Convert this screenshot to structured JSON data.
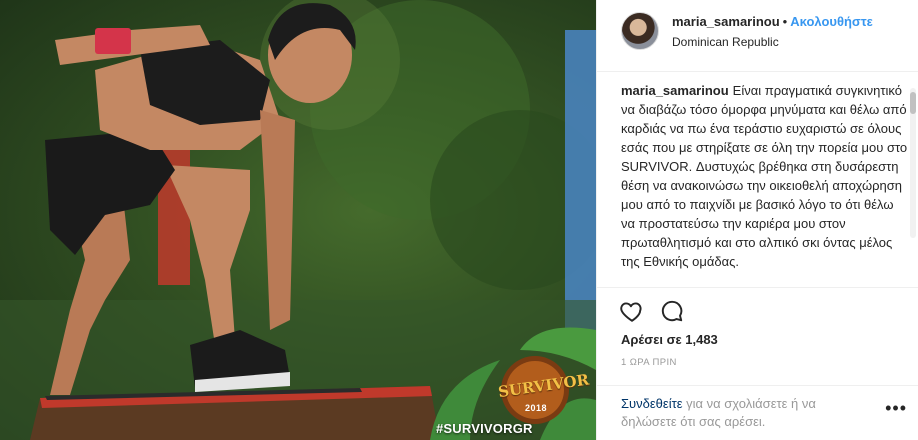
{
  "post": {
    "username": "maria_samarinou",
    "separator": "•",
    "follow_label": "Ακολουθήστε",
    "location": "Dominican Republic",
    "caption_user": "maria_samarinou",
    "caption_text": "Είναι πραγματικά συγκινητικό να διαβάζω τόσο όμορφα μηνύματα και θέλω από καρδιάς να πω ένα τεράστιο ευχαριστώ σε όλους εσάς που με στηρίξατε σε όλη την πορεία μου στο SURVIVOR. Δυστυχώς βρέθηκα στη δυσάρεστη θέση να ανακοινώσω την οικειοθελή αποχώρηση μου από το παιχνίδι με βασικό λόγο το ότι θέλω να προστατεύσω την καριέρα μου στον πρωταθλητισμό και στο αλπικό σκι όντας μέλος της Εθνικής ομάδας.",
    "likes_label": "Αρέσει σε 1,483",
    "time_label": "1 ΩΡΑ ΠΡΙΝ",
    "login_link": "Συνδεθείτε",
    "login_rest": " για να σχολιάσετε ή να δηλώσετε ότι σας αρέσει.",
    "more_label": "•••",
    "icons": {
      "like": "heart-icon",
      "comment": "comment-icon"
    }
  },
  "photo": {
    "hashtag": "#SURVIVORGR",
    "logo_text": "SURVIVOR",
    "logo_year": "2018"
  },
  "colors": {
    "link": "#3897f0",
    "muted": "#999999",
    "text": "#262626"
  }
}
